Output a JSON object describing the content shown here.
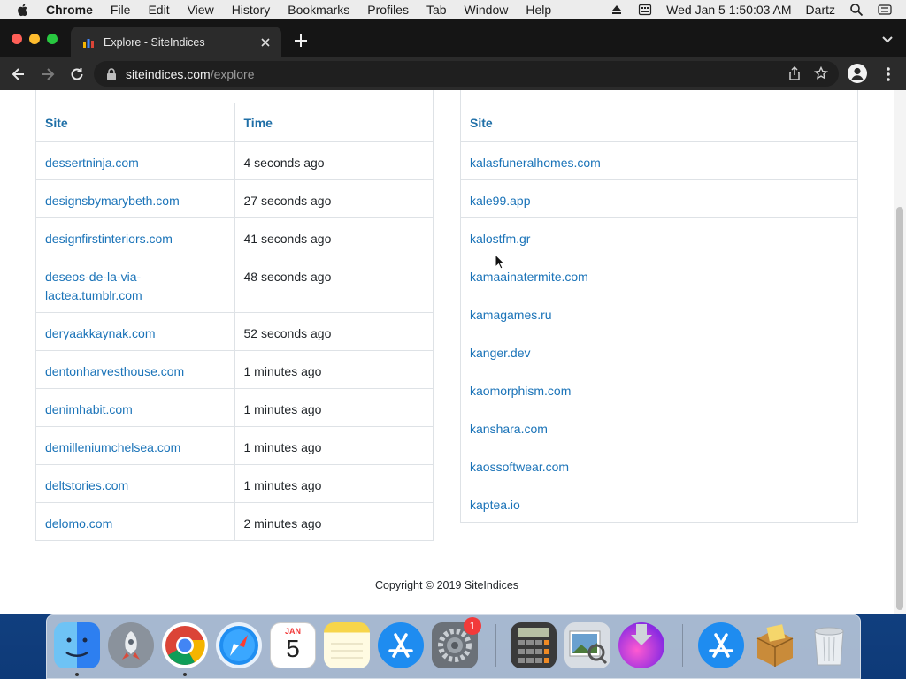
{
  "menubar": {
    "apple_icon": "apple-icon",
    "app_name": "Chrome",
    "items": [
      "File",
      "Edit",
      "View",
      "History",
      "Bookmarks",
      "Profiles",
      "Tab",
      "Window",
      "Help"
    ],
    "clock": "Wed Jan 5  1:50:03 AM",
    "user": "Dartz",
    "status_icons": [
      "eject-icon",
      "keyboard-input-icon",
      "spotlight-search-icon",
      "control-center-icon"
    ]
  },
  "browser": {
    "tab_title": "Explore - SiteIndices",
    "url_host": "siteindices.com",
    "url_path": "/explore"
  },
  "recent_table": {
    "columns": [
      "Site",
      "Time"
    ],
    "rows": [
      {
        "site": "dessertninja.com",
        "time": "4 seconds ago"
      },
      {
        "site": "designsbymarybeth.com",
        "time": "27 seconds ago"
      },
      {
        "site": "designfirstinteriors.com",
        "time": "41 seconds ago"
      },
      {
        "site": "deseos-de-la-via-lactea.tumblr.com",
        "time": "48 seconds ago"
      },
      {
        "site": "deryaakkaynak.com",
        "time": "52 seconds ago"
      },
      {
        "site": "dentonharvesthouse.com",
        "time": "1 minutes ago"
      },
      {
        "site": "denimhabit.com",
        "time": "1 minutes ago"
      },
      {
        "site": "demilleniumchelsea.com",
        "time": "1 minutes ago"
      },
      {
        "site": "deltstories.com",
        "time": "1 minutes ago"
      },
      {
        "site": "delomo.com",
        "time": "2 minutes ago"
      }
    ]
  },
  "sites_table": {
    "columns": [
      "Site"
    ],
    "rows": [
      "kalasfuneralhomes.com",
      "kale99.app",
      "kalostfm.gr",
      "kamaainatermite.com",
      "kamagames.ru",
      "kanger.dev",
      "kaomorphism.com",
      "kanshara.com",
      "kaossoftwear.com",
      "kaptea.io"
    ]
  },
  "footer": {
    "copyright": "Copyright © 2019 SiteIndices"
  },
  "dock": {
    "apps": [
      "finder",
      "launchpad",
      "chrome",
      "safari",
      "calendar",
      "notes",
      "app-store",
      "system-preferences",
      "calculator",
      "preview",
      "installer",
      "app-store-downloads",
      "archive-utility",
      "trash"
    ],
    "calendar_month": "JAN",
    "calendar_day": "5",
    "system_preferences_badge": "1"
  },
  "colors": {
    "link": "#1a73b8",
    "header_link": "#1f6fa7",
    "toolbar": "#2b2b2b",
    "tabstrip": "#151515"
  }
}
